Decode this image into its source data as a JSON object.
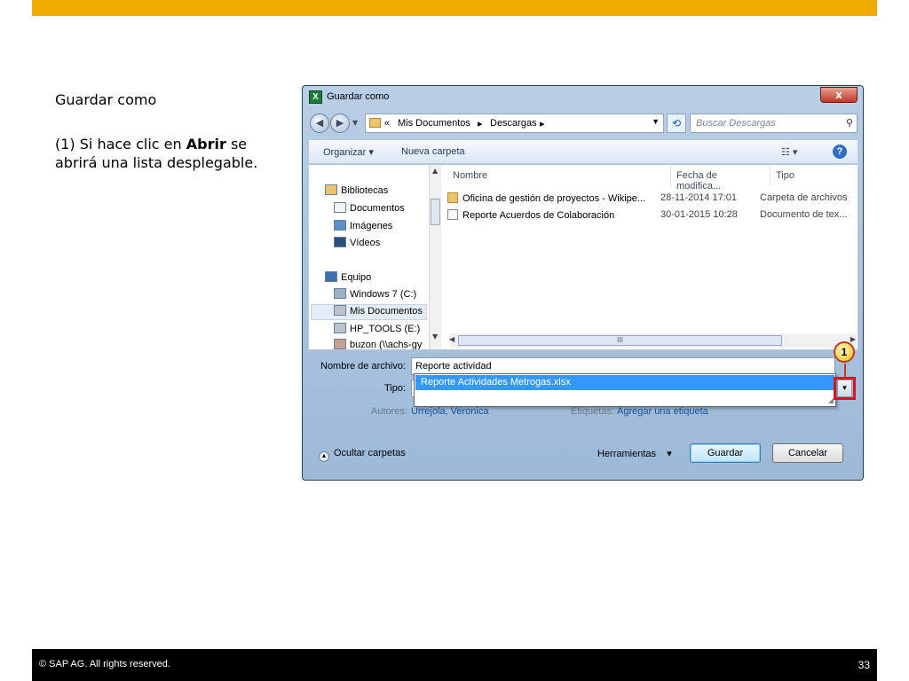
{
  "slide": {
    "heading": "Guardar como",
    "text_prefix": "(1) Si hace clic en ",
    "text_bold": "Abrir",
    "text_suffix": " se abrirá una lista desplegable.",
    "footer_copyright": "©  SAP AG. All rights reserved.",
    "page_number": "33"
  },
  "dialog": {
    "title": "Guardar como",
    "close_label": "x",
    "address": {
      "prefix": "«",
      "segments": [
        "Mis Documentos",
        "Descargas"
      ]
    },
    "search_placeholder": "Buscar Descargas",
    "toolbar": {
      "organize": "Organizar",
      "new_folder": "Nueva carpeta"
    },
    "nav_pane": {
      "items": [
        {
          "label": "Bibliotecas",
          "icon": "libraries-icon",
          "level": 0
        },
        {
          "label": "Documentos",
          "icon": "documents-icon",
          "level": 1
        },
        {
          "label": "Imágenes",
          "icon": "pictures-icon",
          "level": 1
        },
        {
          "label": "Vídeos",
          "icon": "videos-icon",
          "level": 1
        },
        {
          "label": "Equipo",
          "icon": "computer-icon",
          "level": 0
        },
        {
          "label": "Windows 7 (C:)",
          "icon": "drive-icon",
          "level": 1
        },
        {
          "label": "Mis Documentos",
          "icon": "drive-icon",
          "level": 1,
          "selected": true
        },
        {
          "label": "HP_TOOLS (E:)",
          "icon": "drive-icon",
          "level": 1
        },
        {
          "label": "buzon (\\\\achs-gy",
          "icon": "network-drive-icon",
          "level": 1
        }
      ]
    },
    "columns": [
      "Nombre",
      "Fecha de modifica...",
      "Tipo"
    ],
    "files": [
      {
        "name": "Oficina de gestión de proyectos - Wikipe...",
        "date": "28-11-2014 17:01",
        "type": "Carpeta de archivos",
        "icon": "folder-icon"
      },
      {
        "name": "Reporte Acuerdos de Colaboración",
        "date": "30-01-2015 10:28",
        "type": "Documento de tex...",
        "icon": "document-icon"
      }
    ],
    "scroll_grip": "III",
    "form": {
      "filename_label": "Nombre de archivo:",
      "filename_value": "Reporte actividad",
      "type_label": "Tipo:",
      "dropdown_option": "Reporte Actividades Metrogas.xlsx",
      "authors_label": "Autores:",
      "authors_value": "Urrejola, Veronica",
      "tags_label": "Etiquetas:",
      "tags_value": "Agregar una etiqueta",
      "callout_number": "1"
    },
    "bottom": {
      "hide_folders": "Ocultar carpetas",
      "tools": "Herramientas",
      "save": "Guardar",
      "cancel": "Cancelar"
    }
  },
  "colors": {
    "top_bar": "#f0ab00",
    "footer": "#000000",
    "selection": "#3399ff",
    "highlight": "#d9141b"
  }
}
